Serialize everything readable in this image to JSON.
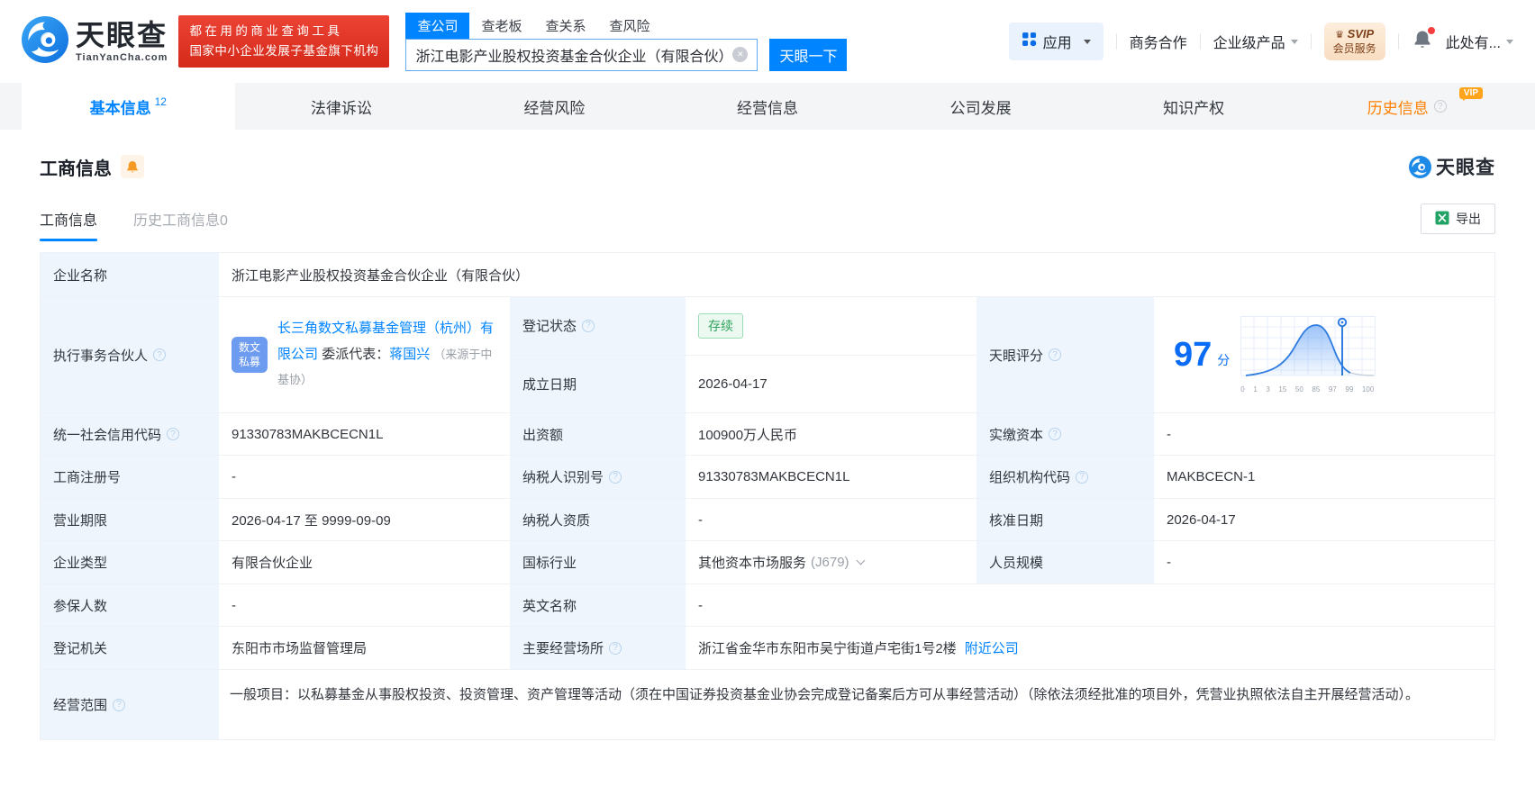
{
  "header": {
    "brand": "天眼查",
    "brand_domain": "TianYanCha.com",
    "promo_line1": "都在用的商业查询工具",
    "promo_line2": "国家中小企业发展子基金旗下机构",
    "search_tabs": [
      {
        "label": "查公司"
      },
      {
        "label": "查老板"
      },
      {
        "label": "查关系"
      },
      {
        "label": "查风险"
      }
    ],
    "search_value": "浙江电影产业股权投资基金合伙企业（有限合伙）",
    "search_button": "天眼一下",
    "apps_label": "应用",
    "biz_coop": "商务合作",
    "enterprise_products": "企业级产品",
    "svip_line1": "SVIP",
    "svip_line2": "会员服务",
    "user_menu": "此处有..."
  },
  "nav_tabs": [
    {
      "label": "基本信息",
      "count": "12"
    },
    {
      "label": "法律诉讼"
    },
    {
      "label": "经营风险"
    },
    {
      "label": "经营信息"
    },
    {
      "label": "公司发展"
    },
    {
      "label": "知识产权"
    },
    {
      "label": "历史信息",
      "vip": "VIP"
    }
  ],
  "section": {
    "title": "工商信息",
    "corner_brand": "天眼查",
    "subtab_active": "工商信息",
    "subtab_history": "历史工商信息0",
    "export_label": "导出"
  },
  "company": {
    "name_label": "企业名称",
    "name": "浙江电影产业股权投资基金合伙企业（有限合伙）",
    "partner_label": "执行事务合伙人",
    "partner_avatar_line1": "数文",
    "partner_avatar_line2": "私募",
    "partner_company": "长三角数文私募基金管理（杭州）有限公司",
    "rep_label": "委派代表：",
    "rep_name": "蒋国兴",
    "rep_source": "（来源于中基协）",
    "reg_status_label": "登记状态",
    "reg_status": "存续",
    "est_date_label": "成立日期",
    "est_date": "2026-04-17",
    "score_label": "天眼评分",
    "score": "97",
    "score_unit": "分",
    "credit_code_label": "统一社会信用代码",
    "credit_code": "91330783MAKBCECN1L",
    "capital_label": "出资额",
    "capital": "100900万人民币",
    "paid_capital_label": "实缴资本",
    "paid_capital": "-",
    "reg_no_label": "工商注册号",
    "reg_no": "-",
    "taxpayer_id_label": "纳税人识别号",
    "taxpayer_id": "91330783MAKBCECN1L",
    "org_code_label": "组织机构代码",
    "org_code": "MAKBCECN-1",
    "term_label": "营业期限",
    "term": "2026-04-17 至 9999-09-09",
    "taxpayer_quality_label": "纳税人资质",
    "taxpayer_quality": "-",
    "approval_date_label": "核准日期",
    "approval_date": "2026-04-17",
    "type_label": "企业类型",
    "type": "有限合伙企业",
    "industry_label": "国标行业",
    "industry": "其他资本市场服务",
    "industry_code": "(J679)",
    "staff_label": "人员规模",
    "staff": "-",
    "insured_label": "参保人数",
    "insured": "-",
    "en_name_label": "英文名称",
    "en_name": "-",
    "authority_label": "登记机关",
    "authority": "东阳市市场监督管理局",
    "address_label": "主要经营场所",
    "address": "浙江省金华市东阳市吴宁街道卢宅街1号2楼",
    "nearby_link": "附近公司",
    "scope_label": "经营范围",
    "scope": "一般项目：以私募基金从事股权投资、投资管理、资产管理等活动（须在中国证券投资基金业协会完成登记备案后方可从事经营活动）（除依法须经批准的项目外，凭营业执照依法自主开展经营活动）。"
  },
  "chart_data": {
    "type": "area",
    "title": "天眼评分分布曲线",
    "score": 97,
    "tick_labels": [
      "0",
      "1",
      "3",
      "15",
      "50",
      "85",
      "97",
      "99",
      "100"
    ]
  },
  "colors": {
    "brand_blue": "#0084ff",
    "promo_red": "#e23a2d",
    "status_green": "#2fa35c",
    "vip_orange": "#ff8000",
    "score_blue": "#0a6cf5",
    "label_cell_bg": "#eef5fc"
  }
}
